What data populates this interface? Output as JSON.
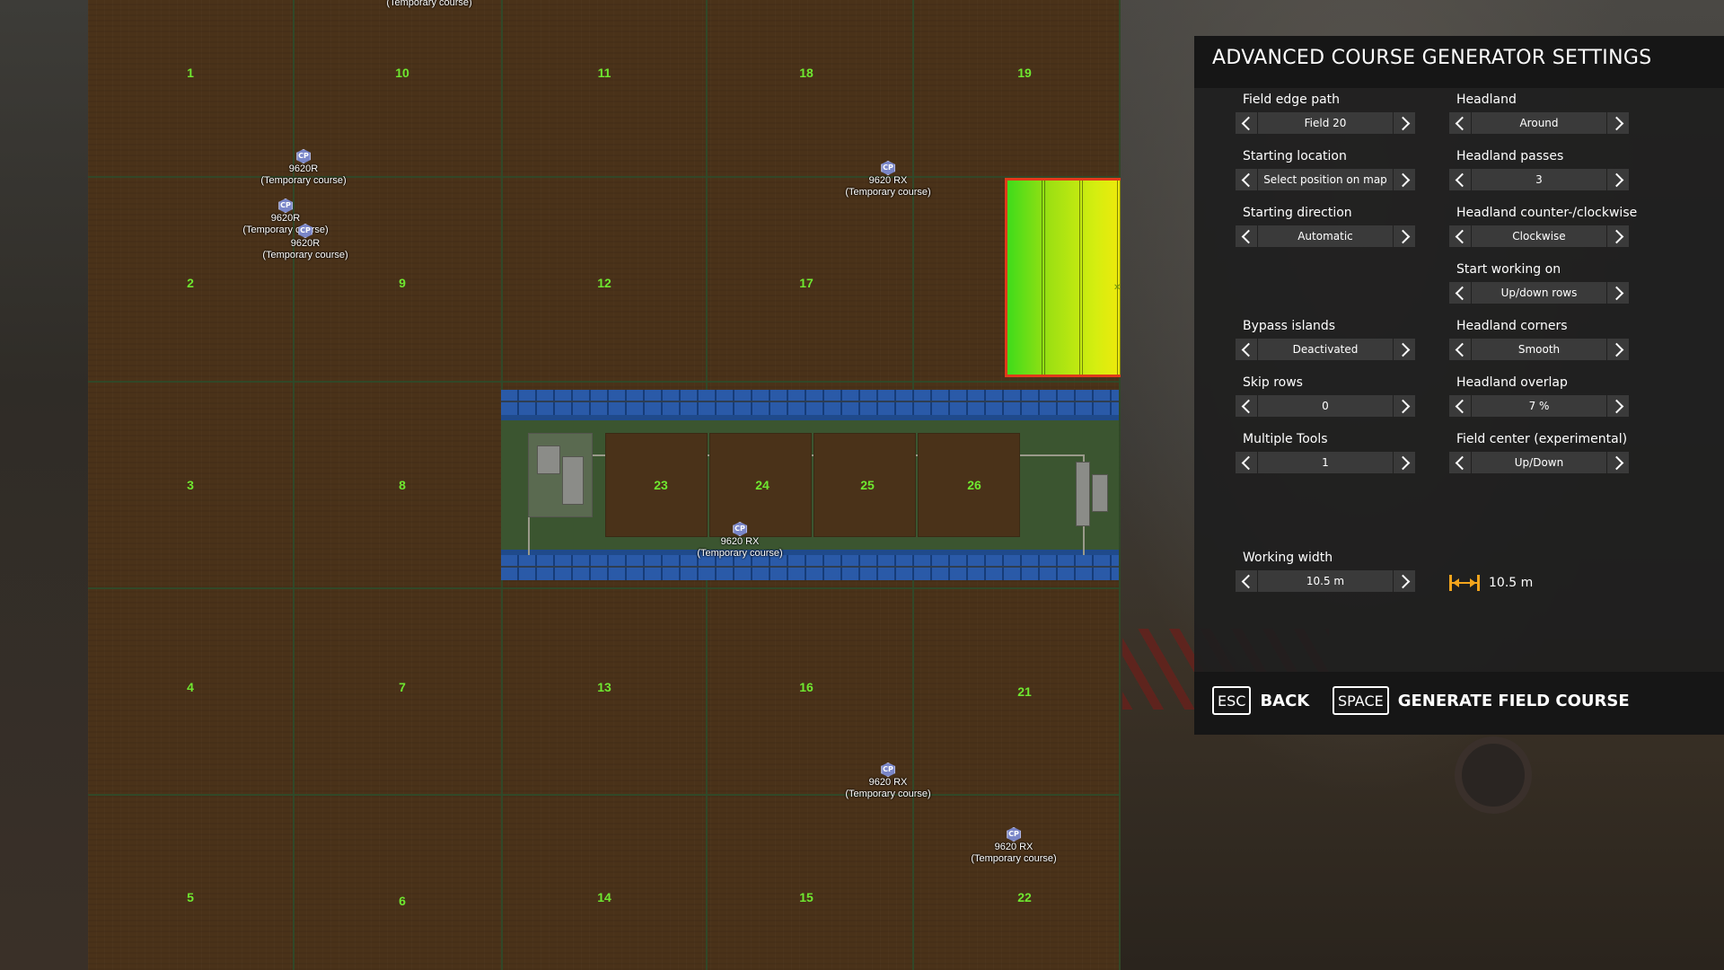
{
  "panel": {
    "title": "ADVANCED COURSE GENERATOR SETTINGS",
    "settings": [
      {
        "label": "Field edge path",
        "value": "Field 20"
      },
      {
        "label": "Headland",
        "value": "Around"
      },
      {
        "label": "Starting location",
        "value": "Select position on map"
      },
      {
        "label": "Headland passes",
        "value": "3"
      },
      {
        "label": "Starting direction",
        "value": "Automatic"
      },
      {
        "label": "Headland counter-/clockwise",
        "value": "Clockwise"
      },
      {
        "label": "Start working on",
        "value": "Up/down rows"
      },
      {
        "label": "Bypass islands",
        "value": "Deactivated"
      },
      {
        "label": "Headland corners",
        "value": "Smooth"
      },
      {
        "label": "Skip rows",
        "value": "0"
      },
      {
        "label": "Headland overlap",
        "value": "7 %"
      },
      {
        "label": "Multiple Tools",
        "value": "1"
      },
      {
        "label": "Field center (experimental)",
        "value": "Up/Down"
      },
      {
        "label": "Working width",
        "value": "10.5 m"
      }
    ],
    "working_width_display": "10.5 m",
    "actions": {
      "back_key": "ESC",
      "back_label": "BACK",
      "generate_key": "SPACE",
      "generate_label": "GENERATE FIELD COURSE"
    }
  },
  "map": {
    "fields": [
      "1",
      "10",
      "11",
      "18",
      "19",
      "2",
      "9",
      "12",
      "17",
      "3",
      "8",
      "23",
      "24",
      "25",
      "26",
      "4",
      "7",
      "13",
      "16",
      "21",
      "5",
      "6",
      "14",
      "15",
      "22"
    ],
    "vehicles": [
      {
        "name": "",
        "course": "(Temporary course)"
      },
      {
        "name": "9620R",
        "course": "(Temporary course)"
      },
      {
        "name": "9620R",
        "course": "(Temporary course)"
      },
      {
        "name": "9620R",
        "course": "(Temporary course)"
      },
      {
        "name": "9620 RX",
        "course": "(Temporary course)"
      },
      {
        "name": "9620 RX",
        "course": "(Temporary course)"
      },
      {
        "name": "9620 RX",
        "course": "(Temporary course)"
      },
      {
        "name": "9620 RX",
        "course": "(Temporary course)"
      }
    ],
    "vehicle_icon_label": "CP"
  }
}
